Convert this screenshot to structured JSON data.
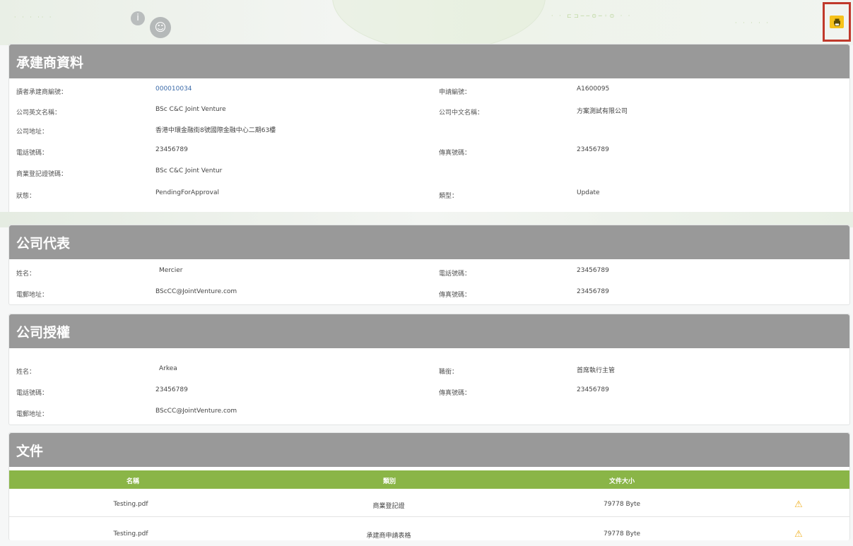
{
  "contractor": {
    "title": "承建商資料",
    "fields": [
      {
        "label": "讀者承建商編號：",
        "value": "000010034"
      },
      {
        "label": "申請編號：",
        "value": "A1600095"
      },
      {
        "label": "公司英文名稱：",
        "value": "BSc C&C Joint Venture"
      },
      {
        "label": "公司中文名稱：",
        "value": "方案測試有限公司"
      },
      {
        "label": "公司地址：",
        "value": "香港中環金融街8號國際金融中心二期63樓"
      },
      {
        "label": "電話號碼：",
        "value": "23456789"
      },
      {
        "label": "傳真號碼：",
        "value": "23456789"
      },
      {
        "label": "商業登記證號碼：",
        "value": "BSc C&C Joint Ventur"
      },
      {
        "label": "狀態：",
        "value": "PendingForApproval"
      },
      {
        "label": "類型：",
        "value": "Update"
      }
    ]
  },
  "representative": {
    "title": "公司代表",
    "fields": [
      {
        "label": "姓名：",
        "value": "Mercier"
      },
      {
        "label": "電話號碼：",
        "value": "23456789"
      },
      {
        "label": "電郵地址：",
        "value": "BScCC@JointVenture.com"
      },
      {
        "label": "傳真號碼：",
        "value": "23456789"
      }
    ]
  },
  "authorization": {
    "title": "公司授權",
    "fields": [
      {
        "label": "姓名：",
        "value": "Arkea"
      },
      {
        "label": "職銜：",
        "value": "首席執行主管"
      },
      {
        "label": "電話號碼：",
        "value": "23456789"
      },
      {
        "label": "傳真號碼：",
        "value": "23456789"
      },
      {
        "label": "電郵地址：",
        "value": "BScCC@JointVenture.com"
      }
    ]
  },
  "documents": {
    "title": "文件",
    "columns": [
      "名稱",
      "類別",
      "文件大小"
    ],
    "rows": [
      {
        "name": "Testing.pdf",
        "type": "商業登記證",
        "size": "79778 Byte"
      },
      {
        "name": "Testing.pdf",
        "type": "承建商申請表格",
        "size": "79778 Byte"
      }
    ]
  },
  "icons": {
    "print": "print-icon",
    "download": "download-icon"
  },
  "colors": {
    "section_header": "#999999",
    "table_header": "#8ab547",
    "print_button": "#f6c21a",
    "highlight": "#c0392b"
  }
}
